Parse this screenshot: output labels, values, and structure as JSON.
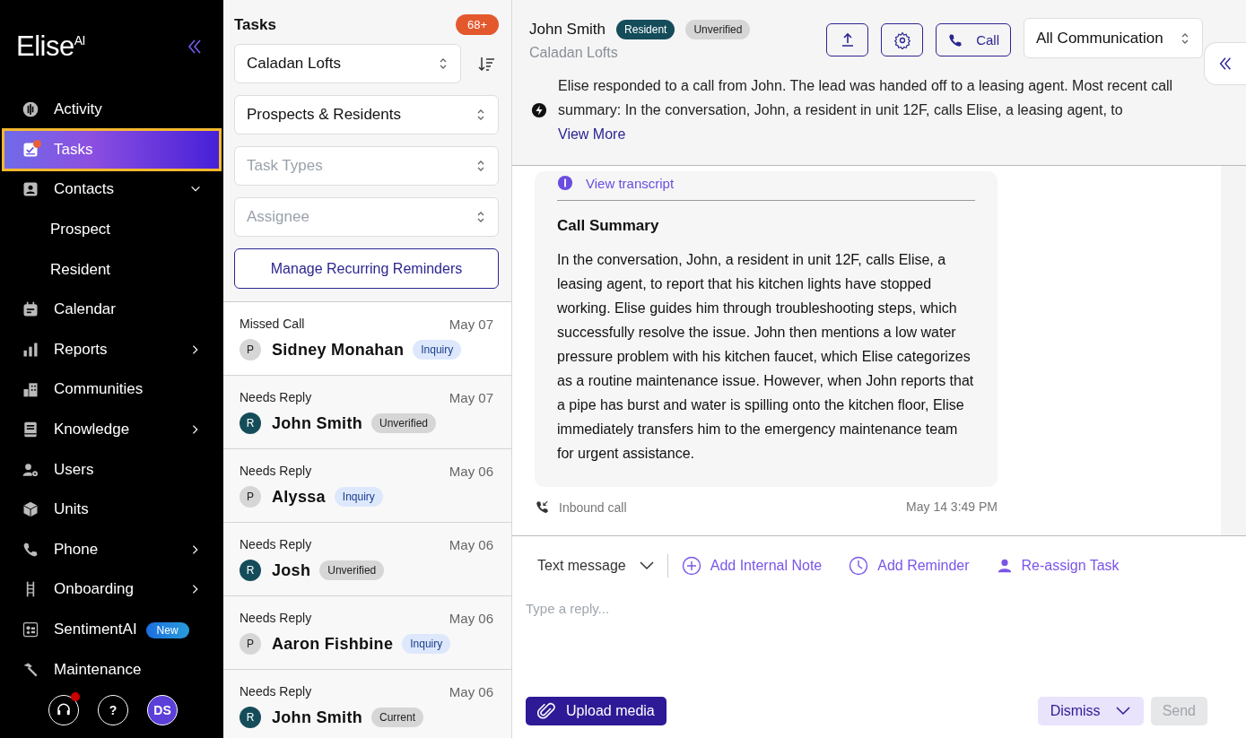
{
  "sidebar": {
    "logo": "Elise$^{AI}$",
    "items": [
      {
        "label": "Activity",
        "kind": "item",
        "selected": false
      },
      {
        "label": "Tasks",
        "kind": "item",
        "selected": true,
        "notification": true
      },
      {
        "label": "Contacts",
        "kind": "item",
        "selected": false,
        "expanded": true
      },
      {
        "label": "Prospect",
        "kind": "subitem",
        "selected": false
      },
      {
        "label": "Resident",
        "kind": "subitem",
        "selected": false
      },
      {
        "label": "Calendar",
        "kind": "item",
        "selected": false
      },
      {
        "label": "Reports",
        "kind": "item",
        "selected": false,
        "expanded": false
      },
      {
        "label": "Communities",
        "kind": "item",
        "selected": false
      },
      {
        "label": "Knowledge",
        "kind": "item",
        "selected": false,
        "expanded": false
      },
      {
        "label": "Users",
        "kind": "item",
        "selected": false
      },
      {
        "label": "Units",
        "kind": "item",
        "selected": false
      },
      {
        "label": "Phone",
        "kind": "item",
        "selected": false,
        "expanded": false
      },
      {
        "label": "Onboarding",
        "kind": "item",
        "selected": false,
        "expanded": false
      },
      {
        "label": "SentimentAI",
        "kind": "item",
        "selected": false,
        "badge": "New"
      },
      {
        "label": "Maintenance",
        "kind": "item",
        "selected": false
      }
    ],
    "footer": {
      "support_notification": true,
      "help": "?",
      "avatar": "DS"
    }
  },
  "tasks": {
    "title": "Tasks",
    "count": "68+",
    "filters": [
      {
        "value": "Caladan Lofts"
      },
      {
        "value": "Prospects & Residents"
      },
      {
        "placeholder": "Task Types"
      },
      {
        "placeholder": "Assignee"
      }
    ],
    "manage_button": "Manage Recurring Reminders",
    "items": [
      {
        "type": "Missed Call",
        "date": "May 07",
        "avatar": {
          "letter": "P",
          "kind": "prospect"
        },
        "name": "Sidney Monahan",
        "tag": {
          "label": "Inquiry",
          "kind": "inquiry"
        }
      },
      {
        "type": "Needs Reply",
        "date": "May 07",
        "avatar": {
          "letter": "R",
          "kind": "resident"
        },
        "name": "John Smith",
        "tag": {
          "label": "Unverified",
          "kind": "status"
        }
      },
      {
        "type": "Needs Reply",
        "date": "May 06",
        "avatar": {
          "letter": "P",
          "kind": "prospect"
        },
        "name": "Alyssa",
        "tag": {
          "label": "Inquiry",
          "kind": "inquiry"
        }
      },
      {
        "type": "Needs Reply",
        "date": "May 06",
        "avatar": {
          "letter": "R",
          "kind": "resident"
        },
        "name": "Josh",
        "tag": {
          "label": "Unverified",
          "kind": "status"
        }
      },
      {
        "type": "Needs Reply",
        "date": "May 06",
        "avatar": {
          "letter": "P",
          "kind": "prospect"
        },
        "name": "Aaron Fishbine",
        "tag": {
          "label": "Inquiry",
          "kind": "inquiry"
        }
      },
      {
        "type": "Needs Reply",
        "date": "May 06",
        "avatar": {
          "letter": "R",
          "kind": "resident"
        },
        "name": "John Smith",
        "tag": {
          "label": "Current",
          "kind": "status"
        }
      }
    ]
  },
  "conversation": {
    "contact": {
      "name": "John Smith",
      "tags": [
        {
          "label": "Resident",
          "kind": "resident"
        },
        {
          "label": "Unverified",
          "kind": "status"
        }
      ],
      "community": "Caladan Lofts"
    },
    "call_button": "Call",
    "filter": "All Communication",
    "summary": "Elise responded to a call from John. The lead was handed off to a leasing agent. Most recent call summary: In the conversation, John, a resident in unit 12F, calls Elise, a leasing agent, to",
    "view_more": "View More",
    "message": {
      "transcript_link": "View transcript",
      "title": "Call Summary",
      "body": "In the conversation, John, a resident in unit 12F, calls Elise, a leasing agent, to report that his kitchen lights have stopped working. Elise guides him through troubleshooting steps, which successfully resolve the issue. John then mentions a low water pressure problem with his kitchen faucet, which Elise categorizes as a routine maintenance issue. However, when John reports that a pipe has burst and water is spilling onto the kitchen floor, Elise immediately transfers him to the emergency maintenance team for urgent assistance.",
      "channel": "Inbound call",
      "time": "May 14 3:49 PM"
    },
    "composer": {
      "channel": "Text message",
      "actions": [
        "Add Internal Note",
        "Add Reminder",
        "Re-assign Task"
      ],
      "placeholder": "Type a reply...",
      "upload": "Upload media",
      "dismiss": "Dismiss",
      "send": {
        "label": "Send",
        "disabled": true
      }
    }
  }
}
